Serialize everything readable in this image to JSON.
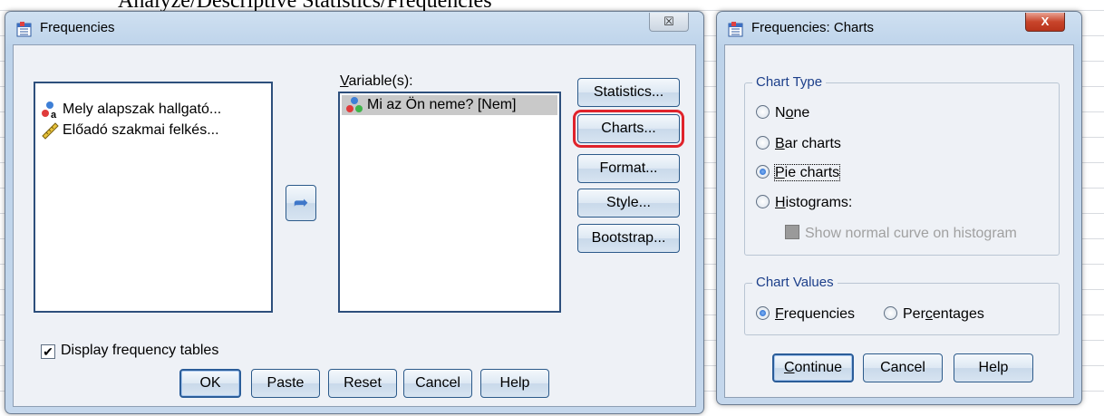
{
  "background": {
    "caption": "Analyze/Descriptive Statistics/Frequencies"
  },
  "frequencies": {
    "title": "Frequencies",
    "close_glyph": "☒",
    "source_list": [
      {
        "label": "Mely alapszak hallgató...",
        "icon": "nominal-variable-icon"
      },
      {
        "label": "Előadó szakmai felkés...",
        "icon": "scale-variable-icon"
      }
    ],
    "variables_label": "Variable(s):",
    "variables_list": [
      {
        "label": "Mi az Ön neme? [Nem]",
        "icon": "nominal-variable-icon"
      }
    ],
    "move_arrow": "➦",
    "side_buttons": [
      "Statistics...",
      "Charts...",
      "Format...",
      "Style...",
      "Bootstrap..."
    ],
    "display_tables": {
      "label": "Display frequency tables",
      "checked": true
    },
    "bottom_buttons": [
      "OK",
      "Paste",
      "Reset",
      "Cancel",
      "Help"
    ]
  },
  "charts_dialog": {
    "title": "Frequencies: Charts",
    "close_glyph": "X",
    "chart_type": {
      "title": "Chart Type",
      "options": [
        "None",
        "Bar charts",
        "Pie charts",
        "Histograms:"
      ],
      "selected": "Pie charts",
      "normal_curve": "Show normal curve on histogram"
    },
    "chart_values": {
      "title": "Chart Values",
      "options": [
        "Frequencies",
        "Percentages"
      ],
      "selected": "Frequencies"
    },
    "buttons": [
      "Continue",
      "Cancel",
      "Help"
    ]
  },
  "colors": {
    "highlight": "#e0232b",
    "group_title": "#1c3f8a"
  }
}
